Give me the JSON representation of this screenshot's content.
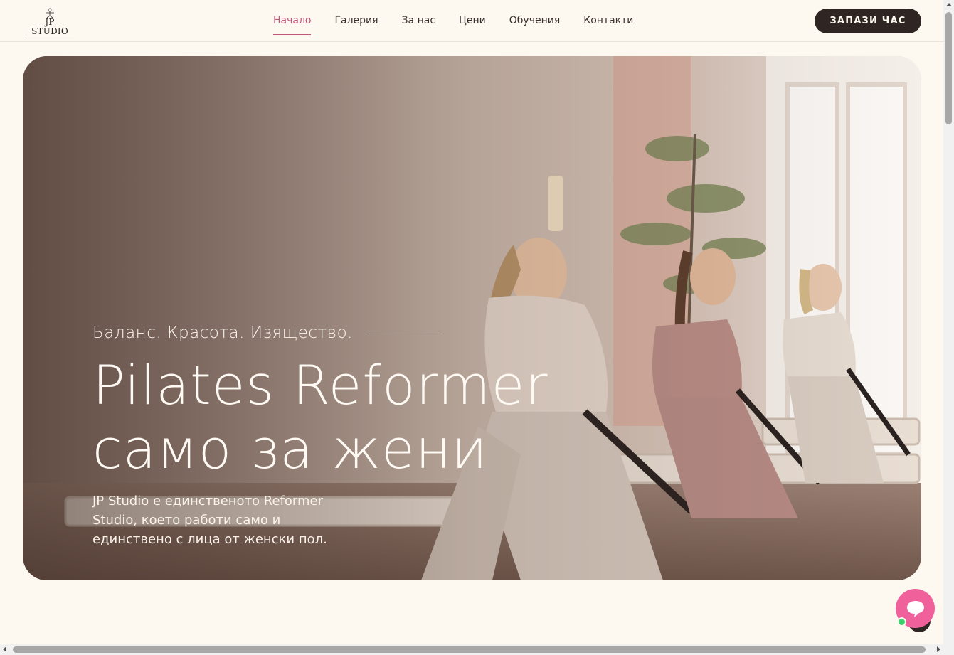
{
  "header": {
    "logo_text": "JP STUDIO",
    "nav": [
      {
        "label": "Начало",
        "active": true
      },
      {
        "label": "Галерия",
        "active": false
      },
      {
        "label": "За нас",
        "active": false
      },
      {
        "label": "Цени",
        "active": false
      },
      {
        "label": "Обучения",
        "active": false
      },
      {
        "label": "Контакти",
        "active": false
      }
    ],
    "cta_label": "ЗАПАЗИ ЧАС"
  },
  "hero": {
    "tagline": "Баланс. Красота. Изящество.",
    "headline_line1": "Pilates Reformer",
    "headline_line2": "само за жени",
    "description": "JP Studio е единственото Reformer Studio, което работи само и единствено с лица от женски пол."
  },
  "chat": {
    "icon": "chat-bubble-icon",
    "status": "online"
  },
  "colors": {
    "background": "#fdf9f1",
    "accent": "#c1567d",
    "button_dark": "#2f2624",
    "chat": "#f0609b",
    "online": "#3ccf6e"
  }
}
